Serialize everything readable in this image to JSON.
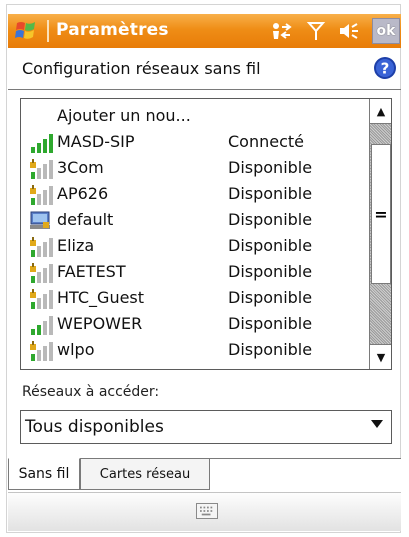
{
  "titlebar": {
    "title": "Paramètres",
    "ok_label": "ok"
  },
  "header": {
    "title": "Configuration réseaux sans fil"
  },
  "list": {
    "rows": [
      {
        "name": "Ajouter un nou...",
        "status": "",
        "icon": "none"
      },
      {
        "name": "MASD-SIP",
        "status": "Connecté",
        "icon": "signal-connected-icon"
      },
      {
        "name": "3Com",
        "status": "Disponible",
        "icon": "signal-secure-icon"
      },
      {
        "name": "AP626",
        "status": "Disponible",
        "icon": "signal-secure-icon"
      },
      {
        "name": "default",
        "status": "Disponible",
        "icon": "adhoc-computer-icon"
      },
      {
        "name": "Eliza",
        "status": "Disponible",
        "icon": "signal-secure-icon"
      },
      {
        "name": "FAETEST",
        "status": "Disponible",
        "icon": "signal-secure-icon"
      },
      {
        "name": "HTC_Guest",
        "status": "Disponible",
        "icon": "signal-secure-icon"
      },
      {
        "name": "WEPOWER",
        "status": "Disponible",
        "icon": "signal-icon"
      },
      {
        "name": "wlpo",
        "status": "Disponible",
        "icon": "signal-secure-icon"
      }
    ]
  },
  "access": {
    "label": "Réseaux à accéder:",
    "selected": "Tous disponibles"
  },
  "tabs": {
    "sansfil": "Sans fil",
    "cartes": "Cartes réseau"
  },
  "colors": {
    "titlebar": "#ef8d16",
    "signal_green": "#2ea82e"
  }
}
